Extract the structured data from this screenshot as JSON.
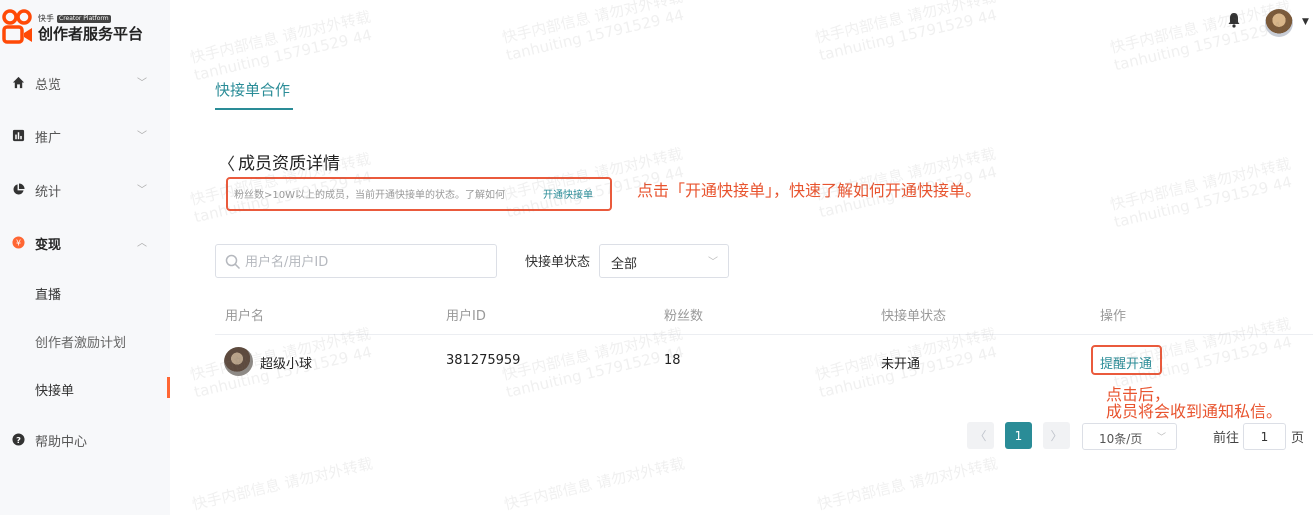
{
  "brand": {
    "logo_small": "快手",
    "logo_pill": "Creator Platform",
    "logo_title": "创作者服务平台"
  },
  "sidebar": {
    "items": [
      {
        "label": "总览",
        "icon": "home-icon"
      },
      {
        "label": "推广",
        "icon": "chart-bar-icon"
      },
      {
        "label": "统计",
        "icon": "pie-chart-icon"
      },
      {
        "label": "变现",
        "icon": "yen-icon"
      }
    ],
    "sub_items": [
      "直播",
      "创作者激励计划",
      "快接单"
    ],
    "help_label": "帮助中心"
  },
  "tabs": {
    "active": "快接单合作"
  },
  "detail": {
    "title": "成员资质详情",
    "note": "粉丝数>10W以上的成员，当前开通快接单的状态。了解如何",
    "note_link": "开通快接单"
  },
  "annotations": {
    "open_tip": "点击「开通快接单」，快速了解如何开通快接单。",
    "remind_tip_line1": "点击后，",
    "remind_tip_line2": "成员将会收到通知私信。"
  },
  "filters": {
    "search_placeholder": "用户名/用户ID",
    "status_label": "快接单状态",
    "status_value": "全部"
  },
  "table": {
    "headers": [
      "用户名",
      "用户ID",
      "粉丝数",
      "快接单状态",
      "操作"
    ],
    "rows": [
      {
        "username": "超级小球",
        "user_id": "381275959",
        "fans": "18",
        "status": "未开通",
        "action": "提醒开通"
      }
    ]
  },
  "pagination": {
    "current_page": "1",
    "page_size": "10条/页",
    "goto_label": "前往",
    "goto_value": "1",
    "page_suffix": "页"
  },
  "watermark": {
    "line1": "快手内部信息 请勿对外转载",
    "line2": "tanhuiting 15791529 44"
  },
  "colors": {
    "accent": "#2a8c97",
    "annotation": "#e8542f",
    "active_nav": "#ff6633"
  }
}
